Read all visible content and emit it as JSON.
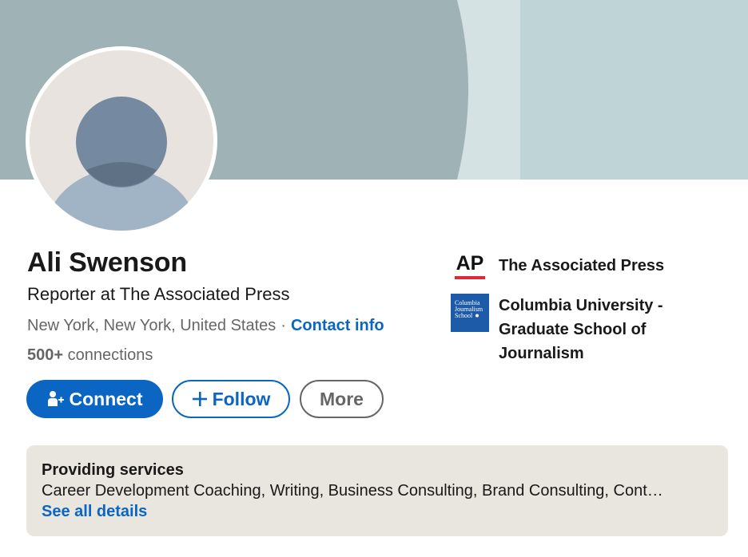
{
  "colors": {
    "accent": "#0a66c2",
    "banner_main": "#9fb3b7",
    "banner_light": "#d5e2e4",
    "banner_right": "#bed4d7",
    "services_bg": "#e9e5df"
  },
  "profile": {
    "name": "Ali Swenson",
    "headline": "Reporter at The Associated Press",
    "location": "New York, New York, United States",
    "separator": "·",
    "contact_info": "Contact info",
    "connections_count": "500+",
    "connections_label": "connections"
  },
  "actions": {
    "connect": "Connect",
    "follow": "Follow",
    "more": "More"
  },
  "organizations": [
    {
      "name": "The Associated Press",
      "logo": "AP"
    },
    {
      "name": "Columbia University - Graduate School of Journalism",
      "logo_lines": [
        "Columbia",
        "Journalism",
        "School"
      ]
    }
  ],
  "services": {
    "title": "Providing services",
    "list": "Career Development Coaching, Writing, Business Consulting, Brand Consulting, Cont…",
    "see_all": "See all details"
  },
  "icons": {
    "connect": "add-person-icon",
    "follow": "plus-icon",
    "avatar": "default-person-avatar"
  }
}
